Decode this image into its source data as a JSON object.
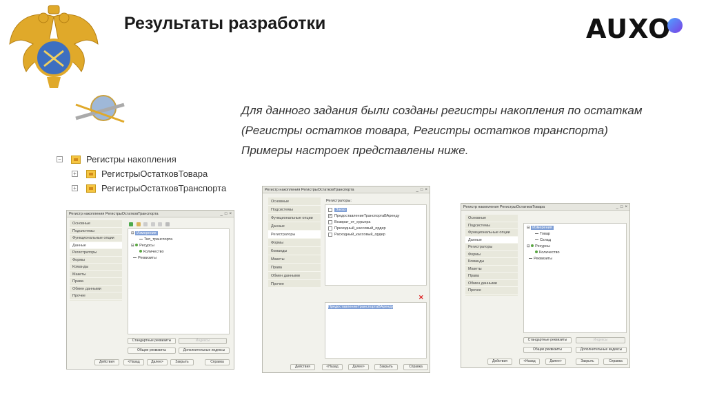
{
  "slide": {
    "title": "Результаты разработки",
    "logo_text": "AUXO",
    "description": "Для данного задания были созданы регистры накопления по остаткам (Регистры остатков товара, Регистры остатков транспорта) Примеры настроек представлены ниже."
  },
  "tree": {
    "root": "Регистры накопления",
    "children": [
      "РегистрыОстатковТовара",
      "РегистрыОстатковТранспорта"
    ]
  },
  "window1": {
    "title": "Регистр накопления РегистрыОстатковТранспорта",
    "nav": [
      "Основные",
      "Подсистемы",
      "Функциональные опции",
      "Данные",
      "Регистраторы",
      "Формы",
      "Команды",
      "Макеты",
      "Права",
      "Обмен данными",
      "Прочее"
    ],
    "tree": [
      "Измерения",
      "Тип_транспорта",
      "Ресурсы",
      "Количество",
      "Реквизиты"
    ],
    "buttons": {
      "std_props": "Стандартные реквизиты",
      "std_props_disabled": "Индексы",
      "common_props": "Общие реквизиты",
      "extra_indexes": "Дополнительные индексы"
    },
    "footer": [
      "Действия",
      "<Назад",
      "Далее>",
      "Закрыть",
      "Справка"
    ]
  },
  "window2": {
    "title": "Регистр накопления РегистрыОстатковТранспорта",
    "nav": [
      "Основные",
      "Подсистемы",
      "Функциональные опции",
      "Данные",
      "Регистраторы",
      "Формы",
      "Команды",
      "Макеты",
      "Права",
      "Обмен данными",
      "Прочее"
    ],
    "list_label": "Регистраторы:",
    "list": [
      "Заказ",
      "ПредоставлениеТранспортаВАренду",
      "Возврат_от_курьера",
      "Приходный_кассовый_ордер",
      "Расходный_кассовый_ордер"
    ],
    "selected_value": "ПредоставлениеТранспортаВАренду",
    "footer": [
      "Действия",
      "<Назад",
      "Далее>",
      "Закрыть",
      "Справка"
    ]
  },
  "window3": {
    "title": "Регистр накопления РегистрыОстатковТовара",
    "nav": [
      "Основные",
      "Подсистемы",
      "Функциональные опции",
      "Данные",
      "Регистраторы",
      "Формы",
      "Команды",
      "Макеты",
      "Права",
      "Обмен данными",
      "Прочее"
    ],
    "tree": [
      "Измерения",
      "Товар",
      "Склад",
      "Ресурсы",
      "Количество",
      "Реквизиты"
    ],
    "buttons": {
      "std_props": "Стандартные реквизиты",
      "std_props_disabled": "Индексы",
      "common_props": "Общие реквизиты",
      "extra_indexes": "Дополнительные индексы"
    },
    "footer": [
      "Действия",
      "<Назад",
      "Далее>",
      "Закрыть",
      "Справка"
    ]
  }
}
